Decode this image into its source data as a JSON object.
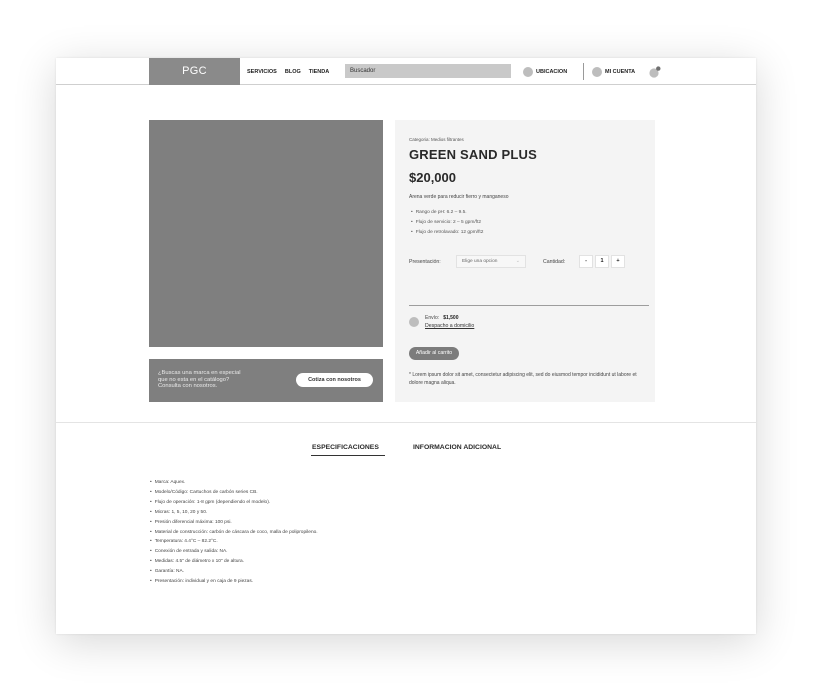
{
  "header": {
    "logo": "PGC",
    "nav": [
      "SERVICIOS",
      "BLOG",
      "TIENDA"
    ],
    "search_placeholder": "Buscador",
    "location_label": "UBICACION",
    "account_label": "MI CUENTA"
  },
  "product": {
    "category": "Categoria: Medios filtrantes",
    "title": "GREEN SAND PLUS",
    "price": "$20,000",
    "description": "Arena verde para reducir fierro y manganeso",
    "bullets": [
      "Rango de pH: 6.2 – 9.5.",
      "Flujo de servicio: 2 – 5 gpm/ft2",
      "Flujo de retrolavado: 12 gpm/ft2"
    ],
    "presentation_label": "Presentación:",
    "presentation_value": "Elige una opcion",
    "quantity_label": "Cantidad:",
    "qty_minus": "-",
    "qty_value": "1",
    "qty_plus": "+",
    "shipping_label": "Envío:",
    "shipping_price": "$1,500",
    "shipping_link": "Despacho a domicilio",
    "add_to_cart": "Añadir al carrito",
    "note": "* Lorem ipsum dolor sit amet, consectetur adipiscing elit, sed do eiusmod tempor incididunt ut labore et dolore magna aliqua."
  },
  "promo": {
    "text": "¿Buscas una marca en especial\nque no esta en el catálogo?\nConsulta con nosotros.",
    "button": "Cotiza con nosotros"
  },
  "tabs": {
    "specs": "ESPECIFICACIONES",
    "info": "INFORMACION ADICIONAL"
  },
  "specs": [
    "Marca: Aquex.",
    "Modelo/Código: Cartuchos de carbón series CB.",
    "Flujo de operación: 1-8 gpm (dependiendo el modelo).",
    "Micras: 1, 5, 10, 20 y 50.",
    "Presión diferencial máxima: 100 psi.",
    "Material de construcción: carbón de cáscara de coco, malla de polipropileno.",
    "Temperatura: 4.4°C – 82.2°C.",
    "Conexión de entrada y salida: NA.",
    "Medidas: 4.5\" de diámetro x 10\" de altura.",
    "Garantía: NA.",
    "Presentación: individual y en caja de 9 piezas."
  ]
}
